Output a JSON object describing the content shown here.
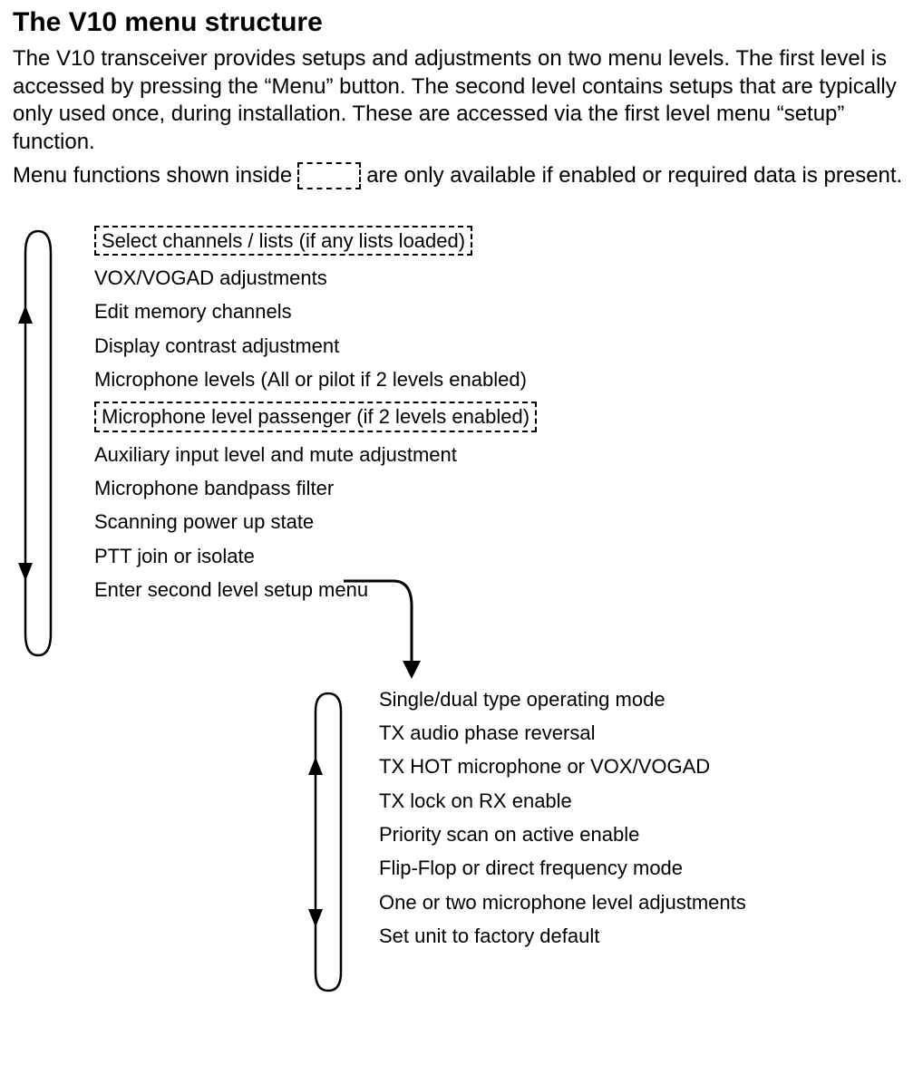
{
  "heading": "The V10 menu structure",
  "intro": "The V10 transceiver provides setups and adjustments on two menu levels. The first level is accessed by pressing the “Menu” button. The second level contains setups that are typically only used once, during installation. These are accessed via the first level menu “setup” function.",
  "inline_before": "Menu functions shown inside",
  "inline_after": "are only available if enabled or required data is present.",
  "level1": [
    {
      "text": "Select channels / lists (if any lists loaded)",
      "dashed": true
    },
    {
      "text": "VOX/VOGAD adjustments",
      "dashed": false
    },
    {
      "text": "Edit memory channels",
      "dashed": false
    },
    {
      "text": "Display contrast adjustment",
      "dashed": false
    },
    {
      "text": "Microphone levels (All or pilot if 2 levels enabled)",
      "dashed": false
    },
    {
      "text": "Microphone level passenger (if 2 levels enabled)",
      "dashed": true
    },
    {
      "text": "Auxiliary input level and mute adjustment",
      "dashed": false
    },
    {
      "text": "Microphone bandpass filter",
      "dashed": false
    },
    {
      "text": "Scanning power up state",
      "dashed": false
    },
    {
      "text": "PTT join or isolate",
      "dashed": false
    },
    {
      "text": "Enter second level setup menu",
      "dashed": false
    }
  ],
  "level2": [
    "Single/dual type operating mode",
    "TX audio phase reversal",
    "TX HOT microphone or VOX/VOGAD",
    "TX lock on RX enable",
    "Priority scan on active enable",
    "Flip-Flop or direct frequency mode",
    "One or two microphone level adjustments",
    "Set unit to factory default"
  ]
}
